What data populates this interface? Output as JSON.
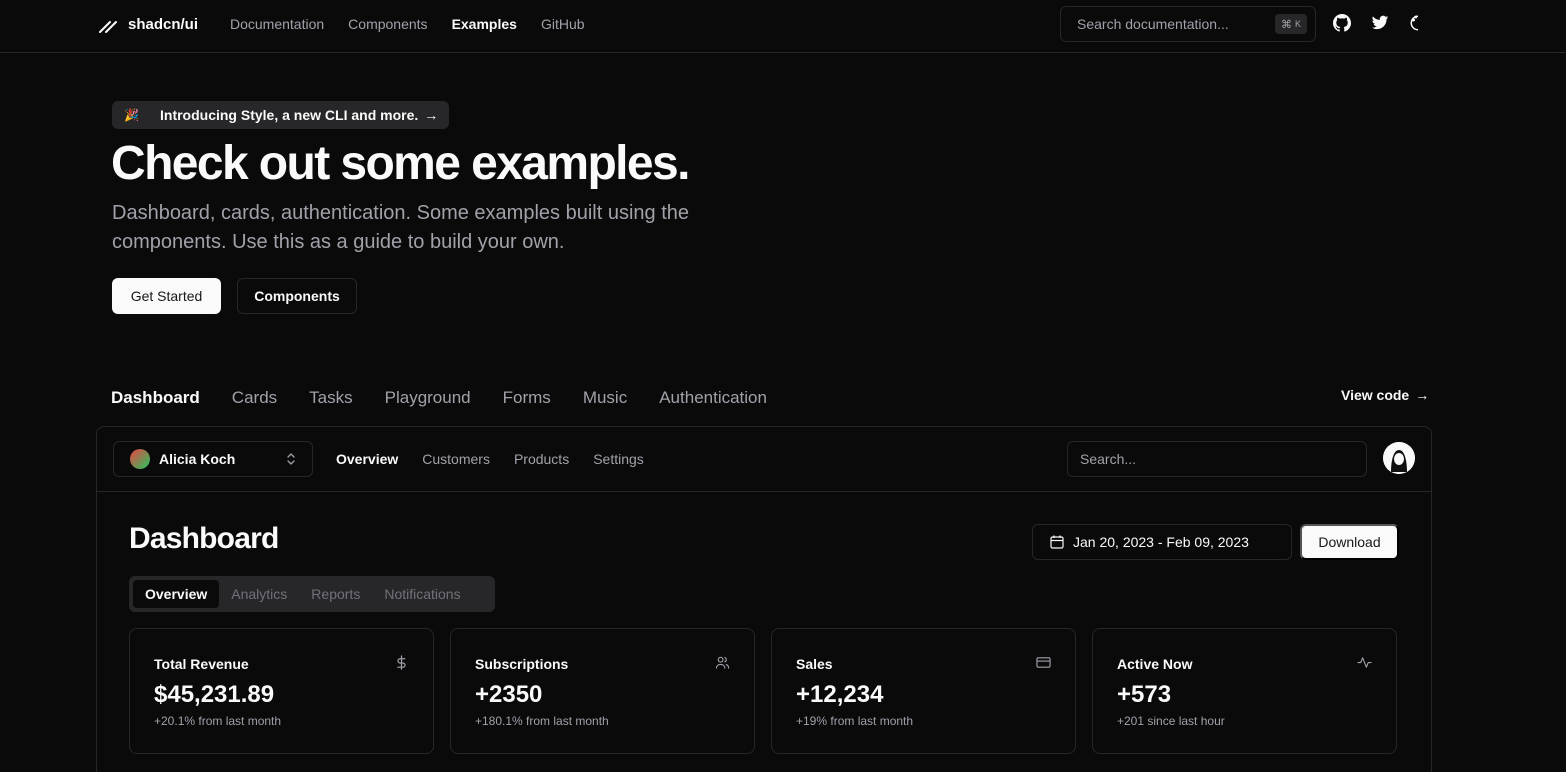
{
  "brand": {
    "name": "shadcn/ui"
  },
  "nav": {
    "links": [
      {
        "label": "Documentation",
        "active": false
      },
      {
        "label": "Components",
        "active": false
      },
      {
        "label": "Examples",
        "active": true
      },
      {
        "label": "GitHub",
        "active": false
      }
    ]
  },
  "search": {
    "placeholder": "Search documentation...",
    "shortcut_symbol": "⌘",
    "shortcut_key": "K"
  },
  "icons": {
    "github": "github-icon",
    "twitter": "twitter-icon",
    "theme": "theme-toggle-icon"
  },
  "hero": {
    "announcement": {
      "emoji": "🎉",
      "text": "Introducing Style, a new CLI and more.",
      "arrow": "→"
    },
    "title": "Check out some examples.",
    "description": "Dashboard, cards, authentication. Some examples built using the components. Use this as a guide to build your own.",
    "primary_button": "Get Started",
    "secondary_button": "Components"
  },
  "example_tabs": [
    {
      "label": "Dashboard",
      "active": true
    },
    {
      "label": "Cards",
      "active": false
    },
    {
      "label": "Tasks",
      "active": false
    },
    {
      "label": "Playground",
      "active": false
    },
    {
      "label": "Forms",
      "active": false
    },
    {
      "label": "Music",
      "active": false
    },
    {
      "label": "Authentication",
      "active": false
    }
  ],
  "view_code": {
    "label": "View code",
    "arrow": "→"
  },
  "dashboard": {
    "team_switcher": {
      "name": "Alicia Koch",
      "chevron": "⌃⌄"
    },
    "main_nav": [
      {
        "label": "Overview",
        "active": true
      },
      {
        "label": "Customers",
        "active": false
      },
      {
        "label": "Products",
        "active": false
      },
      {
        "label": "Settings",
        "active": false
      }
    ],
    "search_placeholder": "Search...",
    "title": "Dashboard",
    "date_range": "Jan 20, 2023 - Feb 09, 2023",
    "download_label": "Download",
    "tabs": [
      {
        "label": "Overview",
        "active": true
      },
      {
        "label": "Analytics",
        "active": false
      },
      {
        "label": "Reports",
        "active": false
      },
      {
        "label": "Notifications",
        "active": false
      }
    ],
    "cards": [
      {
        "title": "Total Revenue",
        "icon": "dollar-icon",
        "value": "$45,231.89",
        "sub": "+20.1% from last month"
      },
      {
        "title": "Subscriptions",
        "icon": "users-icon",
        "value": "+2350",
        "sub": "+180.1% from last month"
      },
      {
        "title": "Sales",
        "icon": "credit-card-icon",
        "value": "+12,234",
        "sub": "+19% from last month"
      },
      {
        "title": "Active Now",
        "icon": "activity-icon",
        "value": "+573",
        "sub": "+201 since last hour"
      }
    ]
  },
  "colors": {
    "background": "#0a0a0b",
    "border": "#27272a",
    "foreground": "#fafafa",
    "muted": "#a1a1aa"
  }
}
